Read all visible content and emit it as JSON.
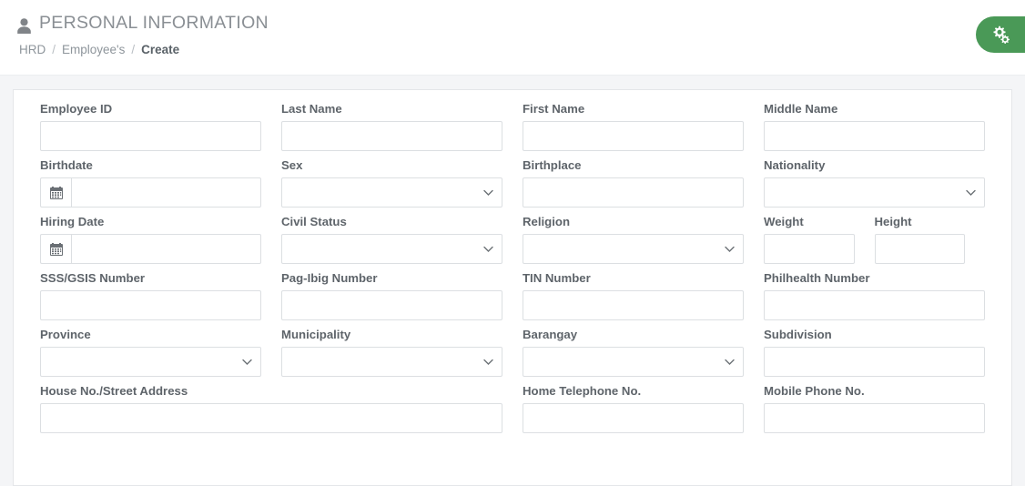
{
  "header": {
    "title": "PERSONAL INFORMATION",
    "title_icon": "user-icon",
    "breadcrumb": [
      {
        "label": "HRD",
        "current": false
      },
      {
        "label": "Employee's",
        "current": false
      },
      {
        "label": "Create",
        "current": true
      }
    ],
    "separator": "/",
    "settings_tab": {
      "icon": "gears-icon",
      "color": "#4a9957"
    }
  },
  "colors": {
    "page_background": "#f4f5f7",
    "card_background": "#ffffff",
    "border": "#dcdfe2",
    "label_text": "#5e646a",
    "accent_green": "#4a9957"
  },
  "form": {
    "rows": [
      {
        "fields": [
          {
            "label": "Employee ID",
            "type": "text",
            "value": "",
            "placeholder": ""
          },
          {
            "label": "Last Name",
            "type": "text",
            "value": "",
            "placeholder": ""
          },
          {
            "label": "First Name",
            "type": "text",
            "value": "",
            "placeholder": ""
          },
          {
            "label": "Middle Name",
            "type": "text",
            "value": "",
            "placeholder": ""
          }
        ]
      },
      {
        "fields": [
          {
            "label": "Birthdate",
            "type": "date",
            "value": "",
            "placeholder": "",
            "icon": "calendar-icon"
          },
          {
            "label": "Sex",
            "type": "select",
            "value": "",
            "options": [
              ""
            ]
          },
          {
            "label": "Birthplace",
            "type": "text",
            "value": "",
            "placeholder": ""
          },
          {
            "label": "Nationality",
            "type": "select",
            "value": "",
            "options": [
              ""
            ]
          }
        ]
      },
      {
        "fields": [
          {
            "label": "Hiring Date",
            "type": "date",
            "value": "",
            "placeholder": "",
            "icon": "calendar-icon"
          },
          {
            "label": "Civil Status",
            "type": "select",
            "value": "",
            "options": [
              ""
            ]
          },
          {
            "label": "Religion",
            "type": "select",
            "value": "",
            "options": [
              ""
            ]
          }
        ],
        "split_last": [
          {
            "label": "Weight",
            "type": "text",
            "value": "",
            "placeholder": ""
          },
          {
            "label": "Height",
            "type": "text",
            "value": "",
            "placeholder": ""
          }
        ]
      },
      {
        "fields": [
          {
            "label": "SSS/GSIS Number",
            "type": "text",
            "value": "",
            "placeholder": ""
          },
          {
            "label": "Pag-Ibig Number",
            "type": "text",
            "value": "",
            "placeholder": ""
          },
          {
            "label": "TIN Number",
            "type": "text",
            "value": "",
            "placeholder": ""
          },
          {
            "label": "Philhealth Number",
            "type": "text",
            "value": "",
            "placeholder": ""
          }
        ]
      },
      {
        "fields": [
          {
            "label": "Province",
            "type": "select",
            "value": "",
            "options": [
              ""
            ]
          },
          {
            "label": "Municipality",
            "type": "select",
            "value": "",
            "options": [
              ""
            ]
          },
          {
            "label": "Barangay",
            "type": "select",
            "value": "",
            "options": [
              ""
            ]
          },
          {
            "label": "Subdivision",
            "type": "text",
            "value": "",
            "placeholder": ""
          }
        ]
      },
      {
        "fields": [
          {
            "label": "House No./Street Address",
            "type": "text",
            "value": "",
            "placeholder": "",
            "wide": true
          },
          {
            "label": "Home Telephone No.",
            "type": "text",
            "value": "",
            "placeholder": ""
          },
          {
            "label": "Mobile Phone No.",
            "type": "text",
            "value": "",
            "placeholder": ""
          }
        ]
      }
    ]
  }
}
